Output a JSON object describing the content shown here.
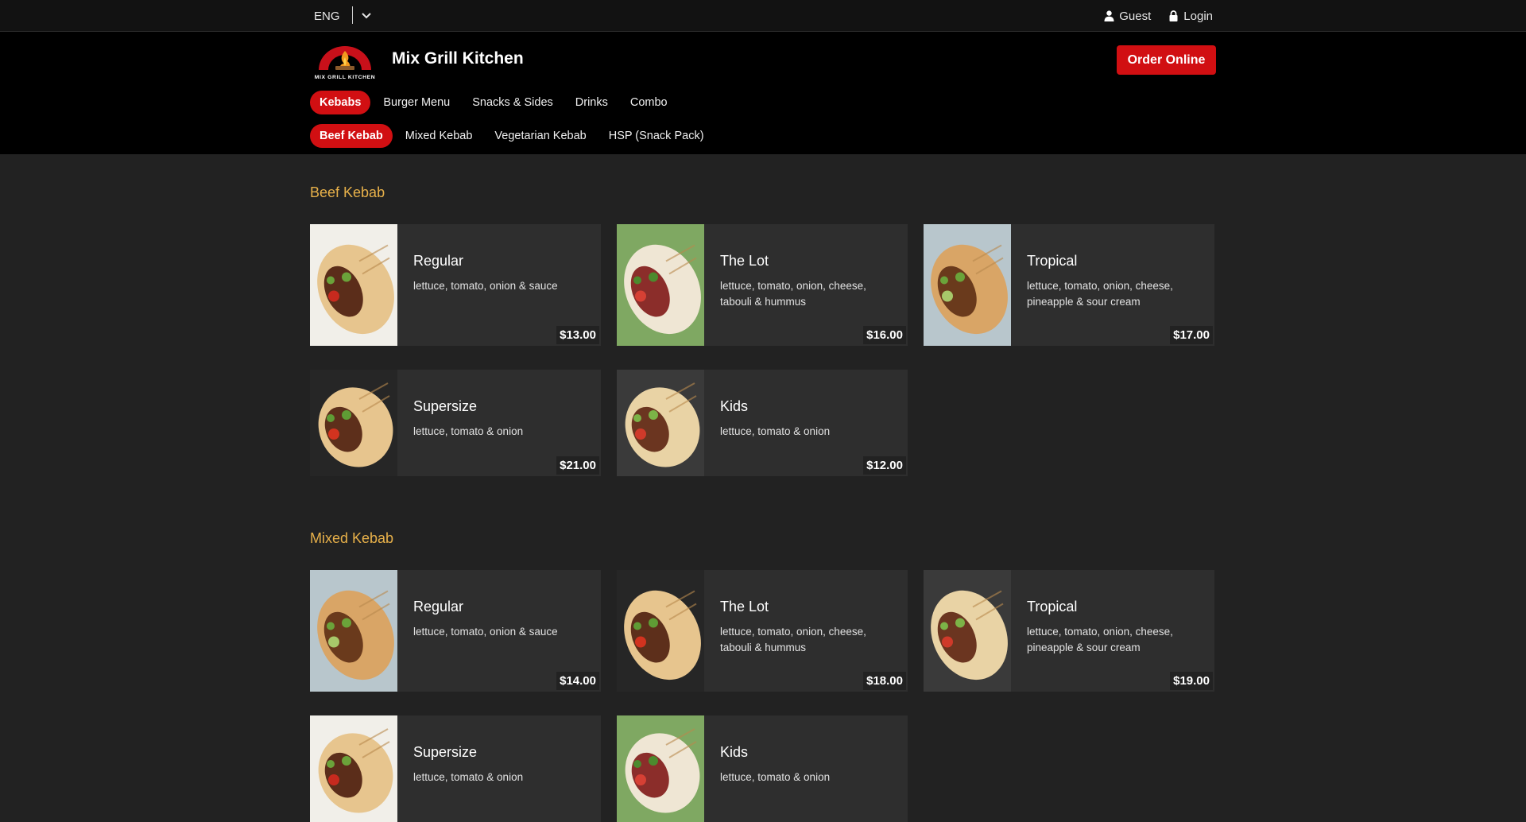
{
  "topbar": {
    "language": "ENG",
    "guest_label": "Guest",
    "login_label": "Login"
  },
  "header": {
    "brand": "Mix Grill Kitchen",
    "logo_text": "MIX GRILL KITCHEN",
    "order_online": "Order Online"
  },
  "categories": [
    {
      "label": "Kebabs",
      "active": true
    },
    {
      "label": "Burger Menu",
      "active": false
    },
    {
      "label": "Snacks & Sides",
      "active": false
    },
    {
      "label": "Drinks",
      "active": false
    },
    {
      "label": "Combo",
      "active": false
    }
  ],
  "subcategories": [
    {
      "label": "Beef Kebab",
      "active": true
    },
    {
      "label": "Mixed Kebab",
      "active": false
    },
    {
      "label": "Vegetarian Kebab",
      "active": false
    },
    {
      "label": "HSP (Snack Pack)",
      "active": false
    }
  ],
  "sections": [
    {
      "title": "Beef Kebab",
      "items": [
        {
          "name": "Regular",
          "desc": "lettuce, tomato, onion & sauce",
          "price": "$13.00"
        },
        {
          "name": "The Lot",
          "desc": "lettuce, tomato, onion, cheese, tabouli & hummus",
          "price": "$16.00"
        },
        {
          "name": "Tropical",
          "desc": "lettuce, tomato, onion, cheese, pineapple & sour cream",
          "price": "$17.00"
        },
        {
          "name": "Supersize",
          "desc": "lettuce, tomato & onion",
          "price": "$21.00"
        },
        {
          "name": "Kids",
          "desc": "lettuce, tomato & onion",
          "price": "$12.00"
        }
      ]
    },
    {
      "title": "Mixed Kebab",
      "items": [
        {
          "name": "Regular",
          "desc": "lettuce, tomato, onion & sauce",
          "price": "$14.00"
        },
        {
          "name": "The Lot",
          "desc": "lettuce, tomato, onion, cheese, tabouli & hummus",
          "price": "$18.00"
        },
        {
          "name": "Tropical",
          "desc": "lettuce, tomato, onion, cheese, pineapple & sour cream",
          "price": "$19.00"
        },
        {
          "name": "Supersize",
          "desc": "lettuce, tomato & onion",
          "price": ""
        },
        {
          "name": "Kids",
          "desc": "lettuce, tomato & onion",
          "price": ""
        }
      ]
    }
  ],
  "colors": {
    "accent": "#d10f12",
    "section_title": "#e8b14a",
    "card_bg": "#2e2e2e",
    "page_bg": "#222222"
  }
}
